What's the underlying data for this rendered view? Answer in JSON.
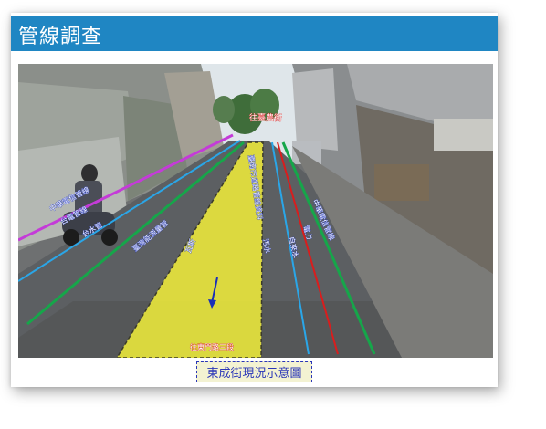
{
  "header": {
    "title": "管線調查"
  },
  "scene": {
    "labels": {
      "top_direction": "往臺農街",
      "bottom_direction": "往東門路三段",
      "telecom_left": "中華電信管線",
      "power_left": "台電管線",
      "water_left": "台水管",
      "green_left": "臺灣能源量管",
      "gas": "瓦斯",
      "road_center": "臺南市道路管線資料",
      "sewer": "污水",
      "water_right": "自來水",
      "power_right": "電力",
      "telecom_right": "中華電信管線"
    },
    "colors": {
      "magenta": "#c43bd8",
      "blue": "#2aa6e8",
      "green": "#16a64a",
      "red": "#d91d1d",
      "yellow": "#f2ee3a"
    }
  },
  "caption": "東成街現況示意圖"
}
